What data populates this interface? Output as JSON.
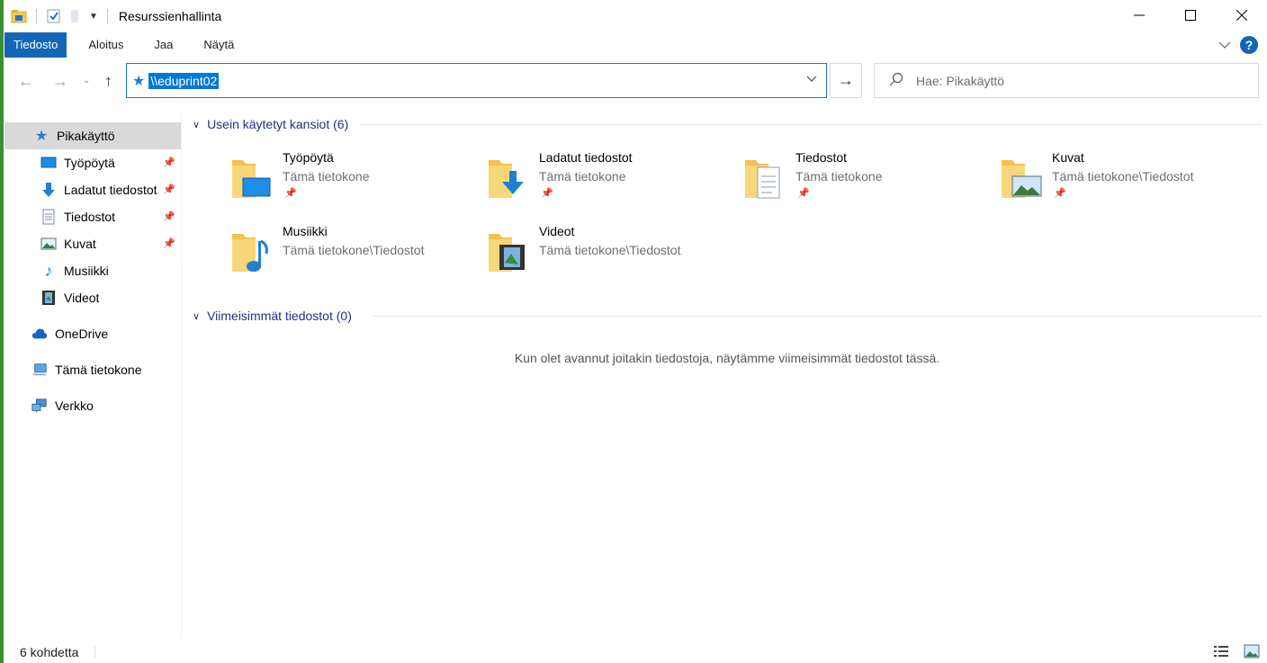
{
  "window": {
    "title": "Resurssienhallinta"
  },
  "ribbon": {
    "tabs": [
      "Tiedosto",
      "Aloitus",
      "Jaa",
      "Näytä"
    ],
    "help": "?"
  },
  "address": {
    "path": "\\\\eduprint02"
  },
  "search": {
    "placeholder": "Hae: Pikakäyttö"
  },
  "sidebar": {
    "items": [
      {
        "label": "Pikakäyttö",
        "icon": "star-icon",
        "pinned": false,
        "selected": true
      },
      {
        "label": "Työpöytä",
        "icon": "desktop-icon",
        "pinned": true
      },
      {
        "label": "Ladatut tiedostot",
        "icon": "download-icon",
        "pinned": true
      },
      {
        "label": "Tiedostot",
        "icon": "document-icon",
        "pinned": true
      },
      {
        "label": "Kuvat",
        "icon": "pictures-icon",
        "pinned": true
      },
      {
        "label": "Musiikki",
        "icon": "music-icon",
        "pinned": false
      },
      {
        "label": "Videot",
        "icon": "video-icon",
        "pinned": false
      },
      {
        "label": "OneDrive",
        "icon": "cloud-icon",
        "pinned": false
      },
      {
        "label": "Tämä tietokone",
        "icon": "computer-icon",
        "pinned": false
      },
      {
        "label": "Verkko",
        "icon": "network-icon",
        "pinned": false
      }
    ]
  },
  "frequent": {
    "header": "Usein käytetyt kansiot (6)",
    "folders": [
      {
        "name": "Työpöytä",
        "location": "Tämä tietokone",
        "pinned": true,
        "icon": "desktop-folder-icon"
      },
      {
        "name": "Ladatut tiedostot",
        "location": "Tämä tietokone",
        "pinned": true,
        "icon": "downloads-folder-icon"
      },
      {
        "name": "Tiedostot",
        "location": "Tämä tietokone",
        "pinned": true,
        "icon": "documents-folder-icon"
      },
      {
        "name": "Kuvat",
        "location": "Tämä tietokone\\Tiedostot",
        "pinned": true,
        "icon": "pictures-folder-icon"
      },
      {
        "name": "Musiikki",
        "location": "Tämä tietokone\\Tiedostot",
        "pinned": false,
        "icon": "music-folder-icon"
      },
      {
        "name": "Videot",
        "location": "Tämä tietokone\\Tiedostot",
        "pinned": false,
        "icon": "videos-folder-icon"
      }
    ]
  },
  "recent": {
    "header": "Viimeisimmät tiedostot (0)",
    "empty_message": "Kun olet avannut joitakin tiedostoja, näytämme viimeisimmät tiedostot tässä."
  },
  "status": {
    "item_count": "6 kohdetta"
  },
  "colors": {
    "accent": "#1366b4",
    "group_header": "#1e3287",
    "selection": "#0078d7",
    "folder": "#f5c95c"
  }
}
